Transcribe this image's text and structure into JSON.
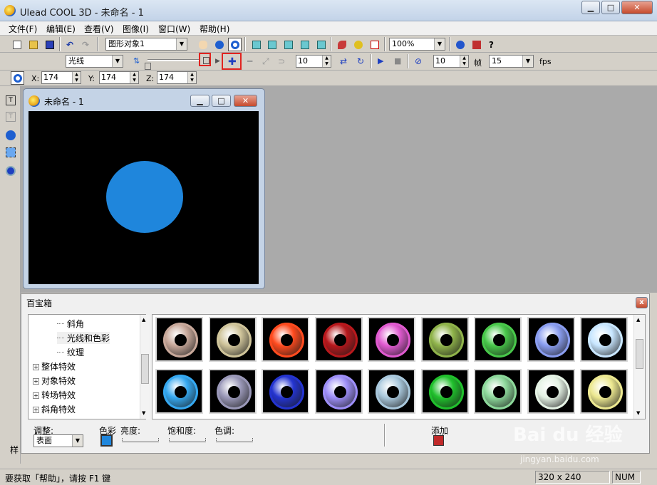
{
  "window": {
    "title": "Ulead COOL 3D - 未命名 - 1",
    "min_label": "▁",
    "max_label": "□",
    "close_label": "✕"
  },
  "menu": [
    "文件(F)",
    "编辑(E)",
    "查看(V)",
    "图像(I)",
    "窗口(W)",
    "帮助(H)"
  ],
  "toolbar1": {
    "object_combo": "图形对象1",
    "zoom_combo": "100%"
  },
  "toolbar2": {
    "light_combo": "光线",
    "spin_a": "10",
    "spin_b": "10",
    "frames_label": "帧",
    "fps_combo": "15",
    "fps_label": "fps"
  },
  "toolbar3": {
    "x_label": "X:",
    "x_value": "174",
    "y_label": "Y:",
    "y_value": "174",
    "z_label": "Z:",
    "z_value": "174"
  },
  "child": {
    "title": "未命名 - 1",
    "circle_color": "#1f86dc"
  },
  "panel": {
    "title": "百宝箱",
    "close_label": "x",
    "tree": [
      {
        "label": "斜角",
        "expandable": false,
        "indent": 1
      },
      {
        "label": "光线和色彩",
        "expandable": false,
        "indent": 1,
        "selected": true
      },
      {
        "label": "纹理",
        "expandable": false,
        "indent": 1
      },
      {
        "label": "整体特效",
        "expandable": true,
        "indent": 0
      },
      {
        "label": "对象特效",
        "expandable": true,
        "indent": 0
      },
      {
        "label": "转场特效",
        "expandable": true,
        "indent": 0
      },
      {
        "label": "斜角特效",
        "expandable": true,
        "indent": 0
      }
    ],
    "gear_colors": [
      "#c8a89a",
      "#cfc49a",
      "#ff4a1e",
      "#b8181c",
      "#e05ad0",
      "#8fb34a",
      "#48c84a",
      "#8a9df0",
      "#c8e6ff",
      "#35a8f0",
      "#9a98b8",
      "#2434d0",
      "#9d8ef8",
      "#a9c8dc",
      "#20c02c",
      "#8cd89a",
      "#e4f2e4",
      "#ece890"
    ],
    "adjust_label": "调整:",
    "adjust_value": "表面",
    "color_label": "色彩",
    "color_value": "#1f86dc",
    "brightness_label": "亮度:",
    "saturation_label": "饱和度:",
    "hue_label": "色调:",
    "add_label": "添加",
    "sample_tab": "样"
  },
  "status": {
    "help": "要获取「帮助」，请按 F1 键",
    "size": "320 x 240",
    "num": "NUM"
  },
  "watermark": {
    "brand": "Bai du 经验",
    "url": "jingyan.baidu.com"
  }
}
